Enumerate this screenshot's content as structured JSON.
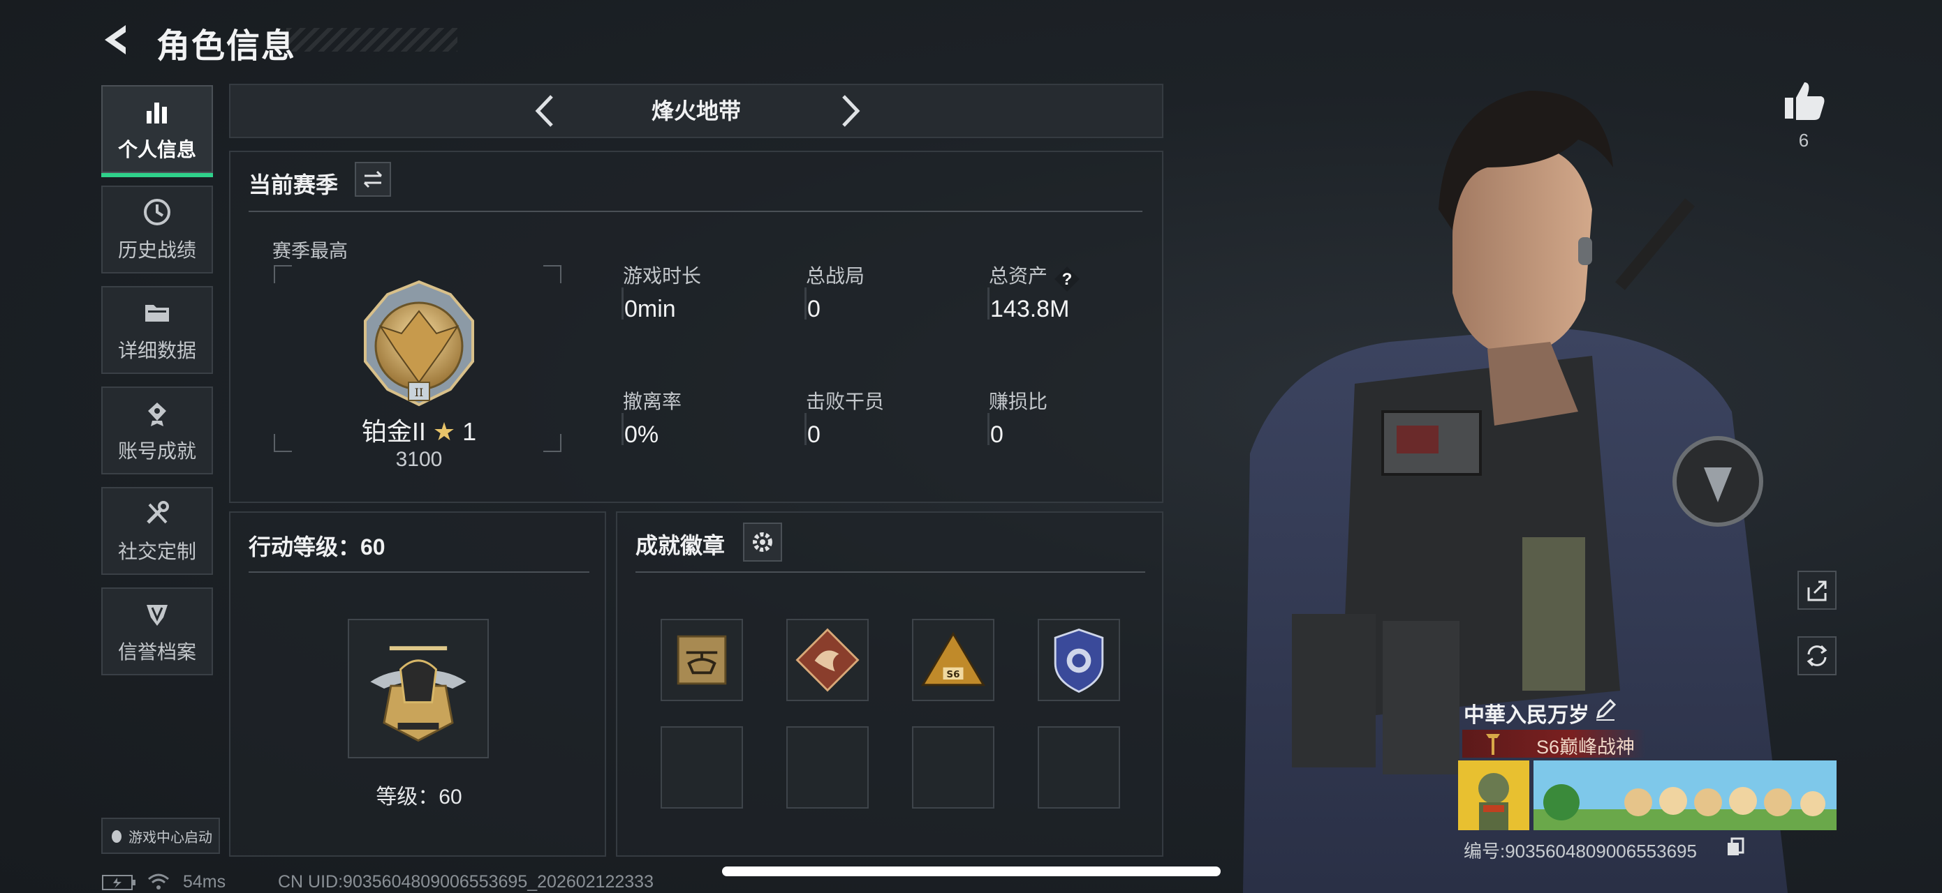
{
  "header": {
    "title": "角色信息"
  },
  "sidebar": {
    "items": [
      {
        "label": "个人信息",
        "icon": "bar-chart-icon",
        "active": true
      },
      {
        "label": "历史战绩",
        "icon": "history-clock-icon",
        "active": false
      },
      {
        "label": "详细数据",
        "icon": "folder-data-icon",
        "active": false
      },
      {
        "label": "账号成就",
        "icon": "achievement-icon",
        "active": false
      },
      {
        "label": "社交定制",
        "icon": "tools-icon",
        "active": false
      },
      {
        "label": "信誉档案",
        "icon": "credit-badge-icon",
        "active": false
      }
    ],
    "game_center": "游戏中心启动"
  },
  "mode": {
    "title": "烽火地带"
  },
  "season": {
    "title": "当前赛季",
    "best_label": "赛季最高",
    "rank_name": "铂金II",
    "rank_stars": "1",
    "rank_score": "3100",
    "stats": [
      {
        "label": "游戏时长",
        "value": "0min"
      },
      {
        "label": "总战局",
        "value": "0"
      },
      {
        "label": "总资产",
        "value": "143.8M"
      },
      {
        "label": "撤离率",
        "value": "0%"
      },
      {
        "label": "击败干员",
        "value": "0"
      },
      {
        "label": "赚损比",
        "value": "0"
      }
    ]
  },
  "level": {
    "title": "行动等级：60",
    "level_text": "等级：60"
  },
  "badges": {
    "title": "成就徽章",
    "slots": [
      "helicopter-badge",
      "dragon-badge",
      "s6-triangle-badge",
      "police-shield-badge",
      "empty",
      "empty",
      "empty",
      "empty"
    ]
  },
  "profile": {
    "likes": "6",
    "name": "中華入民万岁",
    "title": "S6巅峰战神",
    "uid_line": "编号:9035604809006553695"
  },
  "status": {
    "ping": "54ms",
    "cn_uid": "CN UID:9035604809006553695_202602122333"
  },
  "colors": {
    "accent": "#2fd18b",
    "panel_border": "#353b41",
    "background": "#1c2126"
  }
}
